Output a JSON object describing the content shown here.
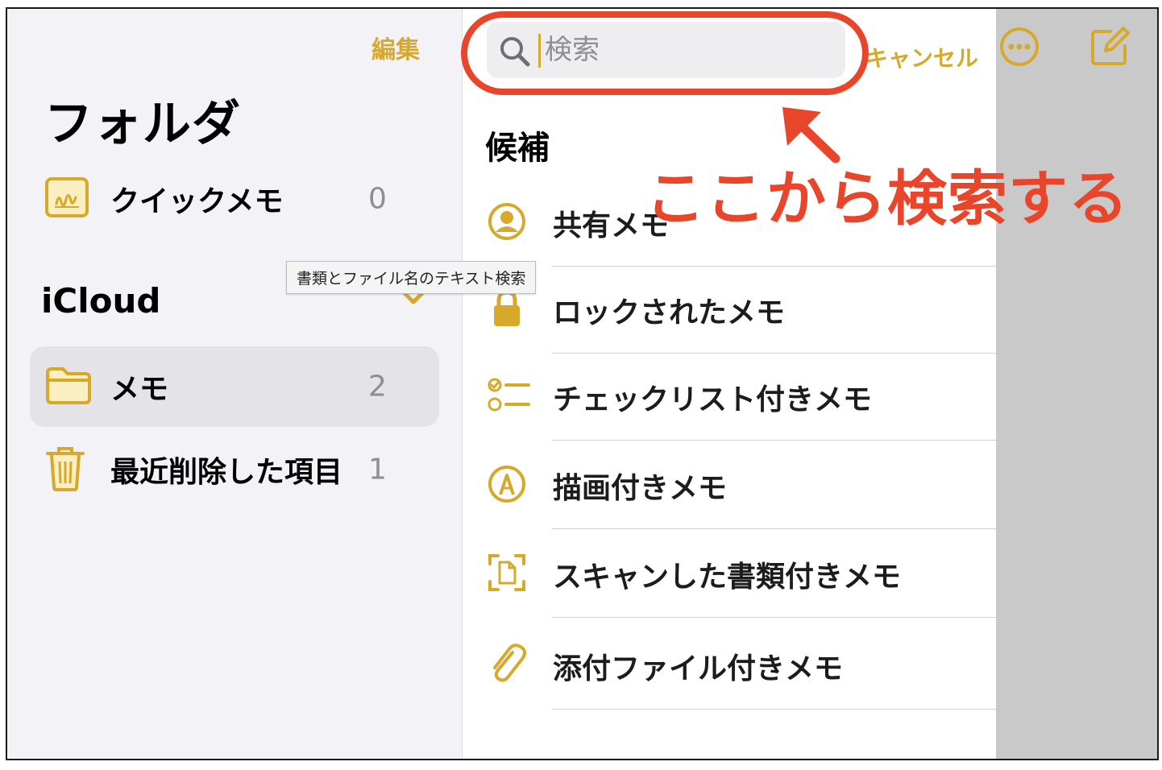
{
  "colors": {
    "accent": "#d7a92b",
    "annotation": "#e8452b",
    "sidebar_bg": "#f2f2f7",
    "selected_row": "#e3e3e8",
    "count_gray": "#8e8e93"
  },
  "sidebar": {
    "edit_label": "編集",
    "title": "フォルダ",
    "quick_note": {
      "label": "クイックメモ",
      "count": "0",
      "icon": "quick-note-icon"
    },
    "icloud_title": "iCloud",
    "folders": [
      {
        "label": "メモ",
        "count": "2",
        "icon": "folder-icon",
        "selected": true
      },
      {
        "label": "最近削除した項目",
        "count": "1",
        "icon": "trash-icon"
      }
    ]
  },
  "tooltip": {
    "text": "書類とファイル名のテキスト検索"
  },
  "search": {
    "placeholder": "検索",
    "cancel_label": "キャンセル",
    "suggestions_title": "候補",
    "suggestions": [
      {
        "label": "共有メモ",
        "icon": "person-circle-icon"
      },
      {
        "label": "ロックされたメモ",
        "icon": "lock-icon"
      },
      {
        "label": "チェックリスト付きメモ",
        "icon": "checklist-icon"
      },
      {
        "label": "描画付きメモ",
        "icon": "pen-circle-icon"
      },
      {
        "label": "スキャンした書類付きメモ",
        "icon": "doc-scan-icon"
      },
      {
        "label": "添付ファイル付きメモ",
        "icon": "paperclip-icon"
      }
    ]
  },
  "toolbar": {
    "more_icon": "ellipsis-circle-icon",
    "compose_icon": "compose-icon"
  },
  "annotation": {
    "text": "ここから検索する"
  }
}
